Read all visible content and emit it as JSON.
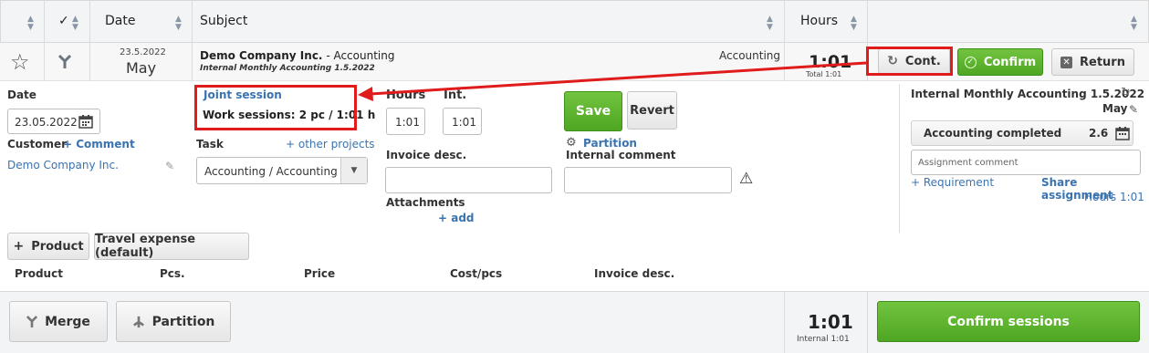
{
  "header": {
    "check_mark": "✓",
    "date_label": "Date",
    "subject_label": "Subject",
    "hours_label": "Hours"
  },
  "entry": {
    "date_small": "23.5.2022",
    "month": "May",
    "company": "Demo Company Inc.",
    "subject_suffix": " - Accounting",
    "subject_sub": "Internal Monthly Accounting 1.5.2022",
    "category": "Accounting",
    "hours": "1:01",
    "total": "Total 1:01",
    "cont_label": "Cont.",
    "confirm_label": "Confirm",
    "return_label": "Return"
  },
  "form": {
    "date_label": "Date",
    "date_value": "23.05.2022",
    "customer_label": "Customer",
    "comment_link": "+ Comment",
    "customer_value": "Demo Company Inc.",
    "joint_session": "Joint session",
    "work_sessions": "Work sessions: 2 pc / 1:01 h",
    "task_label": "Task",
    "other_projects": "+ other projects",
    "task_value": "Accounting / Accounting",
    "hours_label": "Hours",
    "int_label": "Int.",
    "hours_value": "1:01",
    "int_value": "1:01",
    "invoice_desc_label": "Invoice desc.",
    "attachments_label": "Attachments",
    "add_link": "+ add",
    "save_label": "Save",
    "revert_label": "Revert",
    "partition_link": "Partition",
    "internal_comment_label": "Internal comment"
  },
  "assignment": {
    "title": "Internal Monthly Accounting 1.5.2022",
    "month": "May",
    "status": "Accounting completed",
    "status_value": "2.6",
    "comment_placeholder": "Assignment comment",
    "requirement_link": "+ Requirement",
    "share_link": "Share assignment",
    "hours": "Hours 1:01"
  },
  "products": {
    "product_button": "Product",
    "travel_button": "Travel expense (default)",
    "columns": [
      "Product",
      "Pcs.",
      "Price",
      "Cost/pcs",
      "Invoice desc."
    ]
  },
  "footer": {
    "merge_label": "Merge",
    "partition_label": "Partition",
    "hours": "1:01",
    "internal": "Internal 1:01",
    "confirm_sessions": "Confirm sessions"
  },
  "colors": {
    "accent_green": "#4ea622",
    "link_blue": "#3a73b0",
    "highlight_red": "#e01b1b"
  }
}
